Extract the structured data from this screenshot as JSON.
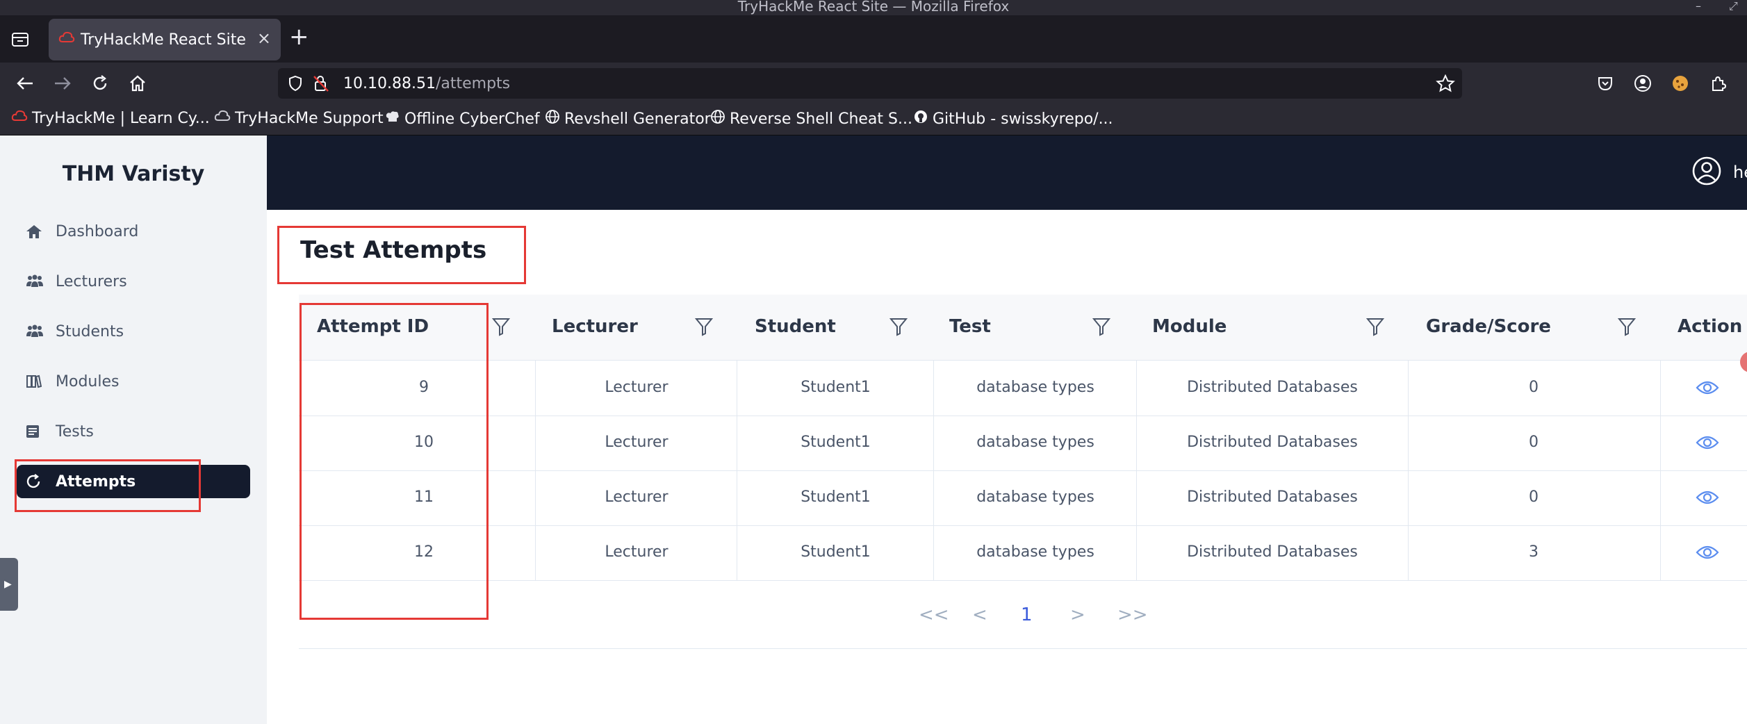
{
  "window": {
    "title": "TryHackMe React Site — Mozilla Firefox"
  },
  "tab": {
    "title": "TryHackMe React Site",
    "close": "×",
    "new_tab": "+"
  },
  "address": {
    "host": "10.10.88.51",
    "path": "/attempts"
  },
  "bookmarks": [
    "TryHackMe | Learn Cy...",
    "TryHackMe Support",
    "Offline CyberChef",
    "Revshell Generator",
    "Reverse Shell Cheat S...",
    "GitHub - swisskyrepo/..."
  ],
  "sidebar": {
    "brand": "THM Varisty",
    "items": [
      {
        "label": "Dashboard",
        "icon": "home-icon"
      },
      {
        "label": "Lecturers",
        "icon": "users-icon"
      },
      {
        "label": "Students",
        "icon": "users-icon"
      },
      {
        "label": "Modules",
        "icon": "book-icon"
      },
      {
        "label": "Tests",
        "icon": "list-icon"
      },
      {
        "label": "Attempts",
        "icon": "refresh-icon",
        "active": true
      }
    ]
  },
  "header": {
    "user_partial": "he"
  },
  "page": {
    "title": "Test Attempts"
  },
  "table": {
    "columns": [
      "Attempt ID",
      "Lecturer",
      "Student",
      "Test",
      "Module",
      "Grade/Score",
      "Action"
    ],
    "rows": [
      [
        "9",
        "Lecturer",
        "Student1",
        "database types",
        "Distributed Databases",
        "0"
      ],
      [
        "10",
        "Lecturer",
        "Student1",
        "database types",
        "Distributed Databases",
        "0"
      ],
      [
        "11",
        "Lecturer",
        "Student1",
        "database types",
        "Distributed Databases",
        "0"
      ],
      [
        "12",
        "Lecturer",
        "Student1",
        "database types",
        "Distributed Databases",
        "3"
      ]
    ]
  },
  "pagination": {
    "first": "<<",
    "prev": "<",
    "current": "1",
    "next": ">",
    "last": ">>"
  },
  "colors": {
    "accent": "#141b2d",
    "highlight": "#e53935",
    "link": "#3b5bdb"
  }
}
